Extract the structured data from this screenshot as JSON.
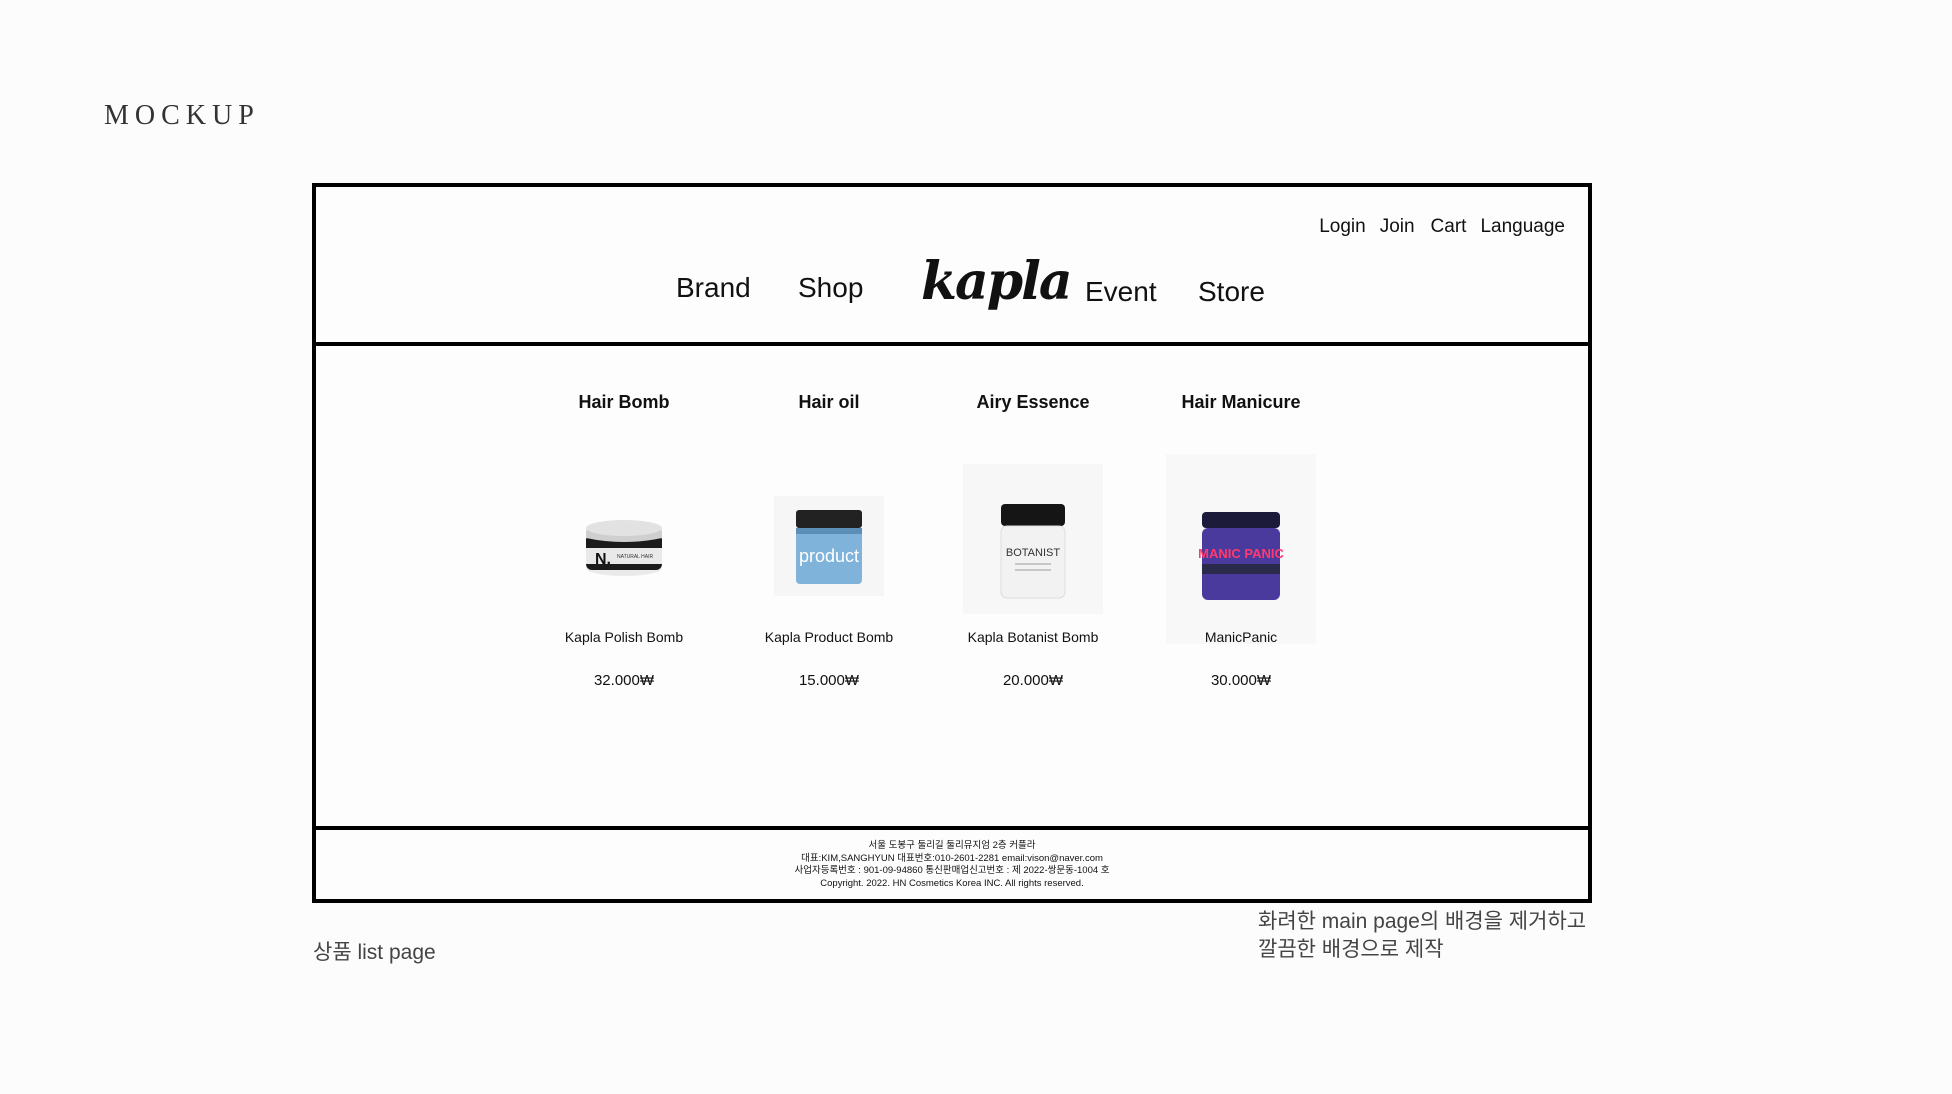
{
  "mockup_title": "MOCKUP",
  "header": {
    "util": {
      "login": "Login",
      "join": "Join",
      "cart": "Cart",
      "language": "Language"
    },
    "nav": {
      "brand": "Brand",
      "shop": "Shop",
      "event": "Event",
      "store": "Store"
    },
    "logo": "kapla"
  },
  "products": [
    {
      "category": "Hair Bomb",
      "name": "Kapla Polish Bomb",
      "price": "32.000₩",
      "jar_label": "N."
    },
    {
      "category": "Hair oil",
      "name": "Kapla Product Bomb",
      "price": "15.000₩",
      "jar_label": "product"
    },
    {
      "category": "Airy Essence",
      "name": "Kapla Botanist Bomb",
      "price": "20.000₩",
      "jar_label": "BOTANIST"
    },
    {
      "category": "Hair Manicure",
      "name": "ManicPanic",
      "price": "30.000₩",
      "jar_label": "MANIC PANIC"
    }
  ],
  "footer": {
    "line1": "서울 도봉구 둘리길 둘리뮤지엄 2층 커플라",
    "line2": "대표:KIM,SANGHYUN  대표번호:010-2601-2281 email:vison@naver.com",
    "line3": "사업자등록번호 : 901-09-94860  통신판매업신고번호 : 제 2022-쌍문동-1004 호",
    "line4": "Copyright. 2022. HN Cosmetics Korea INC. All rights reserved."
  },
  "notes": {
    "left": "상품 list page",
    "right_line1": "화려한 main page의 배경을 제거하고",
    "right_line2": "깔끔한 배경으로 제작"
  },
  "colors": {
    "frame": "#000000",
    "background": "#fcfcfc",
    "manic_purple": "#4b3a9e",
    "product_blue": "#7fb3d9"
  }
}
